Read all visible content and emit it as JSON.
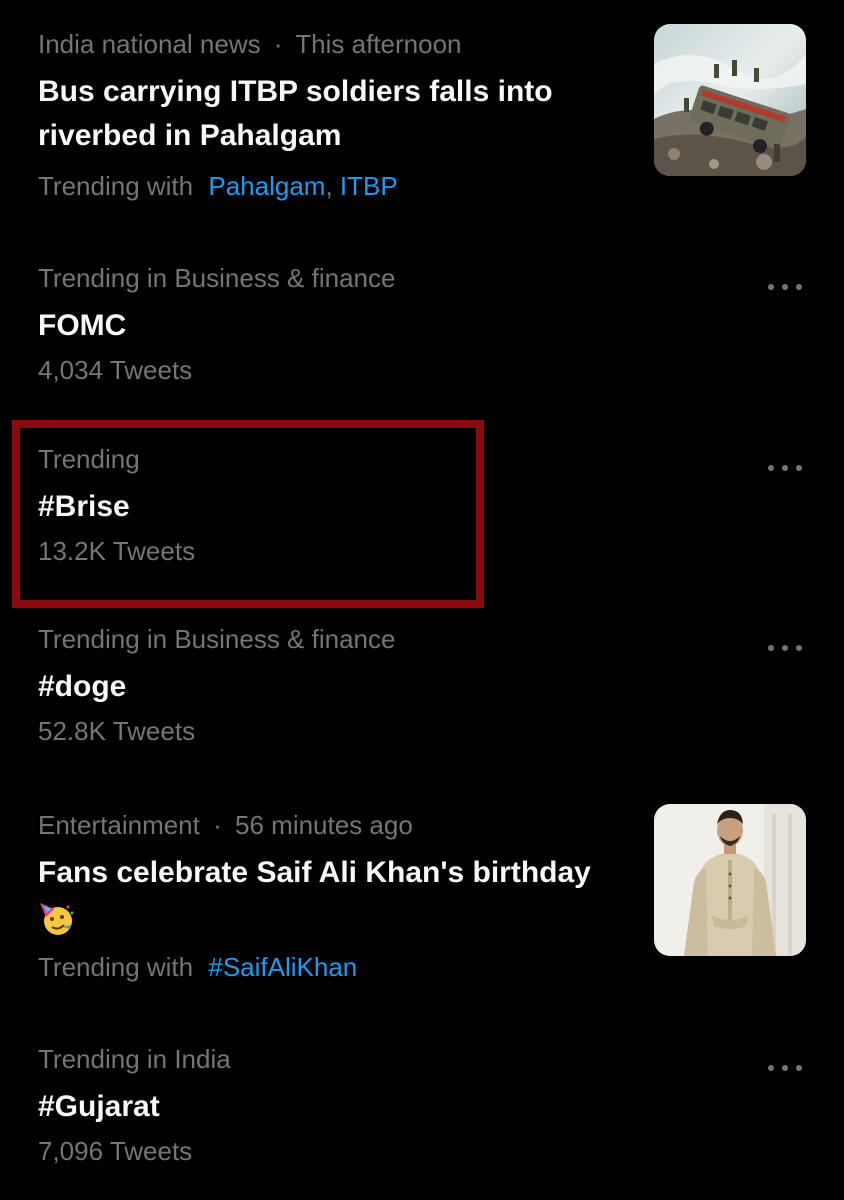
{
  "colors": {
    "background": "#000000",
    "primary_text": "#f7f9f9",
    "secondary_text": "#71767b",
    "link": "#1d9bf0",
    "highlight_box": "#8b0a10"
  },
  "trends": [
    {
      "meta_source": "India national news",
      "meta_sep": "·",
      "meta_time": "This afternoon",
      "title": "Bus carrying ITBP soldiers falls into riverbed in Pahalgam",
      "trending_with_label": "Trending with",
      "trending_with_links": [
        "Pahalgam",
        "ITBP"
      ],
      "link_sep": ",",
      "thumbnail": "bus-accident-photo"
    },
    {
      "meta": "Trending in Business & finance",
      "title": "FOMC",
      "count": "4,034 Tweets",
      "more_icon": "more-icon"
    },
    {
      "meta": "Trending",
      "title": "#Brise",
      "count": "13.2K Tweets",
      "more_icon": "more-icon",
      "highlighted": true
    },
    {
      "meta": "Trending in Business & finance",
      "title": "#doge",
      "count": "52.8K Tweets",
      "more_icon": "more-icon"
    },
    {
      "meta_source": "Entertainment",
      "meta_sep": "·",
      "meta_time": "56 minutes ago",
      "title": "Fans celebrate Saif Ali Khan's birthday",
      "emoji": "party-face-icon",
      "trending_with_label": "Trending with",
      "trending_with_links": [
        "#SaifAliKhan"
      ],
      "thumbnail": "saif-ali-khan-photo"
    },
    {
      "meta": "Trending in India",
      "title": "#Gujarat",
      "count": "7,096 Tweets",
      "more_icon": "more-icon"
    }
  ]
}
